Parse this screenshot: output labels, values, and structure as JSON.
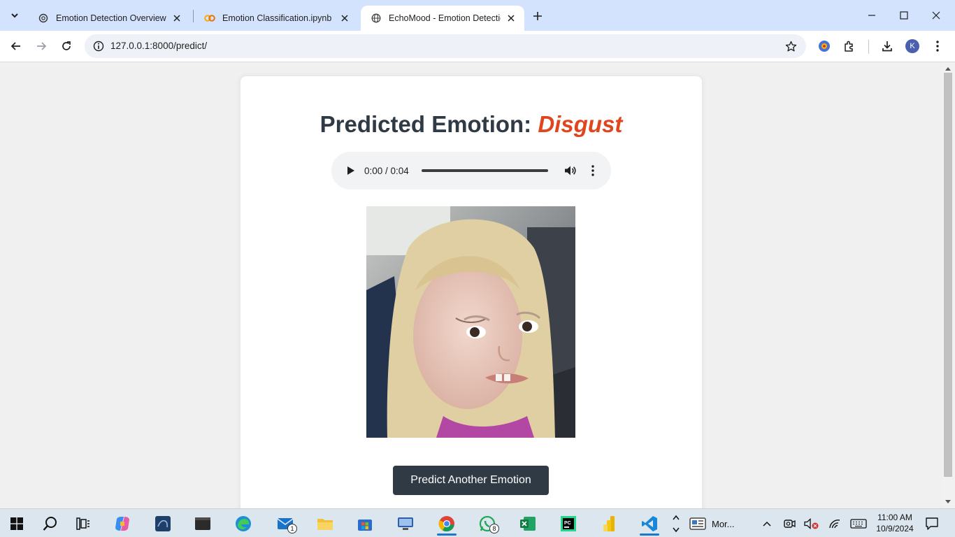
{
  "browser": {
    "tabs": [
      {
        "title": "Emotion Detection Overview",
        "favicon": "openai-icon",
        "active": false
      },
      {
        "title": "Emotion Classification.ipynb - C",
        "favicon": "colab-icon",
        "active": false
      },
      {
        "title": "EchoMood - Emotion Detection",
        "favicon": "globe-icon",
        "active": true
      }
    ],
    "url": "127.0.0.1:8000/predict/"
  },
  "page": {
    "heading_prefix": "Predicted Emotion: ",
    "emotion": "Disgust",
    "emotion_color": "#e0461e",
    "audio": {
      "time": "0:00 / 0:04"
    },
    "button_label": "Predict Another Emotion"
  },
  "taskbar": {
    "apps": [
      {
        "name": "start-icon"
      },
      {
        "name": "search-icon"
      },
      {
        "name": "task-view-icon"
      },
      {
        "name": "copilot-icon"
      },
      {
        "name": "mysql-workbench-icon"
      },
      {
        "name": "terminal-icon"
      },
      {
        "name": "edge-icon"
      },
      {
        "name": "mail-icon",
        "badge": "1"
      },
      {
        "name": "file-explorer-icon"
      },
      {
        "name": "microsoft-store-icon"
      },
      {
        "name": "remote-desktop-icon"
      },
      {
        "name": "chrome-icon",
        "active": true
      },
      {
        "name": "whatsapp-icon",
        "badge": "8"
      },
      {
        "name": "excel-icon"
      },
      {
        "name": "pycharm-icon"
      },
      {
        "name": "power-bi-icon"
      },
      {
        "name": "vscode-icon",
        "active": true
      }
    ],
    "news_label": "Mor...",
    "clock_time": "11:00 AM",
    "clock_date": "10/9/2024"
  }
}
